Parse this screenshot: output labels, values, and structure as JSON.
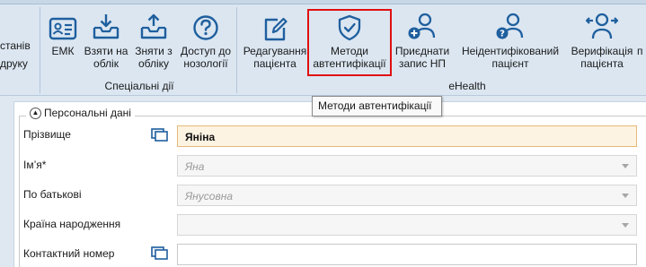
{
  "ribbon": {
    "left_edge_labels": {
      "top": "станів",
      "bottom": "друку"
    },
    "buttons": [
      {
        "id": "emk",
        "label": "ЕМК",
        "icon": "id-card-icon"
      },
      {
        "id": "register",
        "label": "Взяти на\nоблік",
        "icon": "inbox-download-icon"
      },
      {
        "id": "deregister",
        "label": "Зняти з\nобліку",
        "icon": "inbox-upload-icon"
      },
      {
        "id": "nosology",
        "label": "Доступ до\nнозології",
        "icon": "question-circle-icon"
      },
      {
        "id": "edit-patient",
        "label": "Редагування\nпацієнта",
        "icon": "edit-icon"
      },
      {
        "id": "auth-methods",
        "label": "Методи\nавтентифікації",
        "icon": "shield-check-icon"
      },
      {
        "id": "attach-record",
        "label": "Приєднати\nзапис НП",
        "icon": "user-plus-icon"
      },
      {
        "id": "unidentified",
        "label": "Неідентифікований\nпацієнт",
        "icon": "user-question-icon"
      },
      {
        "id": "verify",
        "label": "Верифікація\nпацієнта",
        "icon": "user-arrows-icon"
      },
      {
        "id": "more",
        "label": "п",
        "icon": ""
      }
    ],
    "groups": {
      "special": "Спеціальні дії",
      "ehealth": "eHealth"
    }
  },
  "tooltip": "Методи автентифікації",
  "form": {
    "legend": "Персональні дані",
    "fields": [
      {
        "label": "Прізвище",
        "value": "Яніна",
        "state": "active",
        "copy": true,
        "dropdown": false
      },
      {
        "label": "Ім’я*",
        "value": "Яна",
        "state": "disabled",
        "copy": false,
        "dropdown": true
      },
      {
        "label": "По батькові",
        "value": "Янусовна",
        "state": "disabled",
        "copy": false,
        "dropdown": true
      },
      {
        "label": "Країна народження",
        "value": "",
        "state": "disabled",
        "copy": false,
        "dropdown": true
      },
      {
        "label": "Контактний номер",
        "value": "",
        "state": "normal",
        "copy": true,
        "dropdown": false
      }
    ]
  },
  "colors": {
    "icon": "#1f5f9e",
    "highlight": "#e01010",
    "active_field_bg": "#fdf3e2"
  }
}
